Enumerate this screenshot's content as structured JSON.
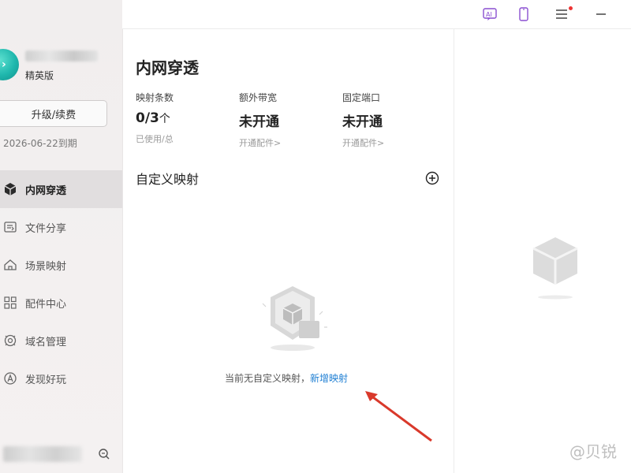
{
  "app": {
    "edition": "精英版",
    "upgrade_label": "升级/续费",
    "expire_date": "2026-06-22到期"
  },
  "sidebar": {
    "items": [
      {
        "label": "内网穿透",
        "icon": "cube-icon",
        "active": true
      },
      {
        "label": "文件分享",
        "icon": "file-share-icon",
        "active": false
      },
      {
        "label": "场景映射",
        "icon": "home-icon",
        "active": false
      },
      {
        "label": "配件中心",
        "icon": "grid-icon",
        "active": false
      },
      {
        "label": "域名管理",
        "icon": "domain-icon",
        "active": false
      },
      {
        "label": "发现好玩",
        "icon": "discover-icon",
        "active": false
      }
    ]
  },
  "topbar": {
    "icons": [
      "ai-icon",
      "mobile-icon",
      "menu-icon",
      "minimize-icon"
    ]
  },
  "main": {
    "title": "内网穿透",
    "stats": [
      {
        "label": "映射条数",
        "value": "0/3",
        "unit": "个",
        "sub": "已使用/总"
      },
      {
        "label": "额外带宽",
        "value": "未开通",
        "unit": "",
        "sub": "开通配件>"
      },
      {
        "label": "固定端口",
        "value": "未开通",
        "unit": "",
        "sub": "开通配件>"
      }
    ],
    "section_title": "自定义映射",
    "empty_text": "当前无自定义映射，",
    "empty_link": "新增映射"
  },
  "right": {
    "watermark": "@贝锐"
  },
  "colors": {
    "accent": "#1f7fd3",
    "active_bg": "#e1dedf",
    "sidebar_bg": "#f1eeee",
    "arrow_red": "#d9392b",
    "logo_teal": "#1fb7ad"
  }
}
